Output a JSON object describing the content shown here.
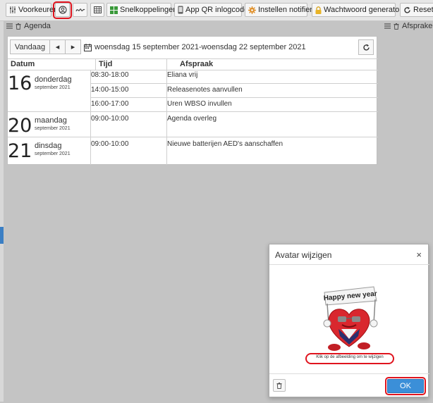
{
  "toolbar": {
    "preferences_label": "Voorkeuren",
    "shortcuts_label": "Snelkoppelingen",
    "qr_label": "App QR inlogcode",
    "notifier_label": "Instellen notifier",
    "password_label": "Wachtwoord generator",
    "reset_label": "Reset l"
  },
  "headers": {
    "agenda": "Agenda",
    "appointments": "Afspraken"
  },
  "calendar": {
    "today_label": "Vandaag",
    "prev_icon": "◂",
    "next_icon": "▸",
    "range": "woensdag 15 september 2021-woensdag 22 september 2021",
    "columns": {
      "date": "Datum",
      "time": "Tijd",
      "appointment": "Afspraak"
    },
    "days": [
      {
        "num": "16",
        "name": "donderdag",
        "monthyear": "september 2021",
        "items": [
          {
            "time": "08:30-18:00",
            "title": "Eliana vrij"
          },
          {
            "time": "14:00-15:00",
            "title": "Releasenotes aanvullen"
          },
          {
            "time": "16:00-17:00",
            "title": "Uren WBSO invullen"
          }
        ]
      },
      {
        "num": "20",
        "name": "maandag",
        "monthyear": "september 2021",
        "items": [
          {
            "time": "09:00-10:00",
            "title": "Agenda overleg"
          }
        ]
      },
      {
        "num": "21",
        "name": "dinsdag",
        "monthyear": "september 2021",
        "items": [
          {
            "time": "09:00-10:00",
            "title": "Nieuwe batterijen AED's aanschaffen"
          }
        ]
      }
    ]
  },
  "dialog": {
    "title": "Avatar wijzigen",
    "close": "×",
    "sign_text": "Happy new year",
    "hint": "Klik op de afbeelding om te wijzigen",
    "ok_label": "OK"
  },
  "colors": {
    "highlight": "#e0141e",
    "primary": "#3b8fd8",
    "heart": "#d9272e"
  }
}
